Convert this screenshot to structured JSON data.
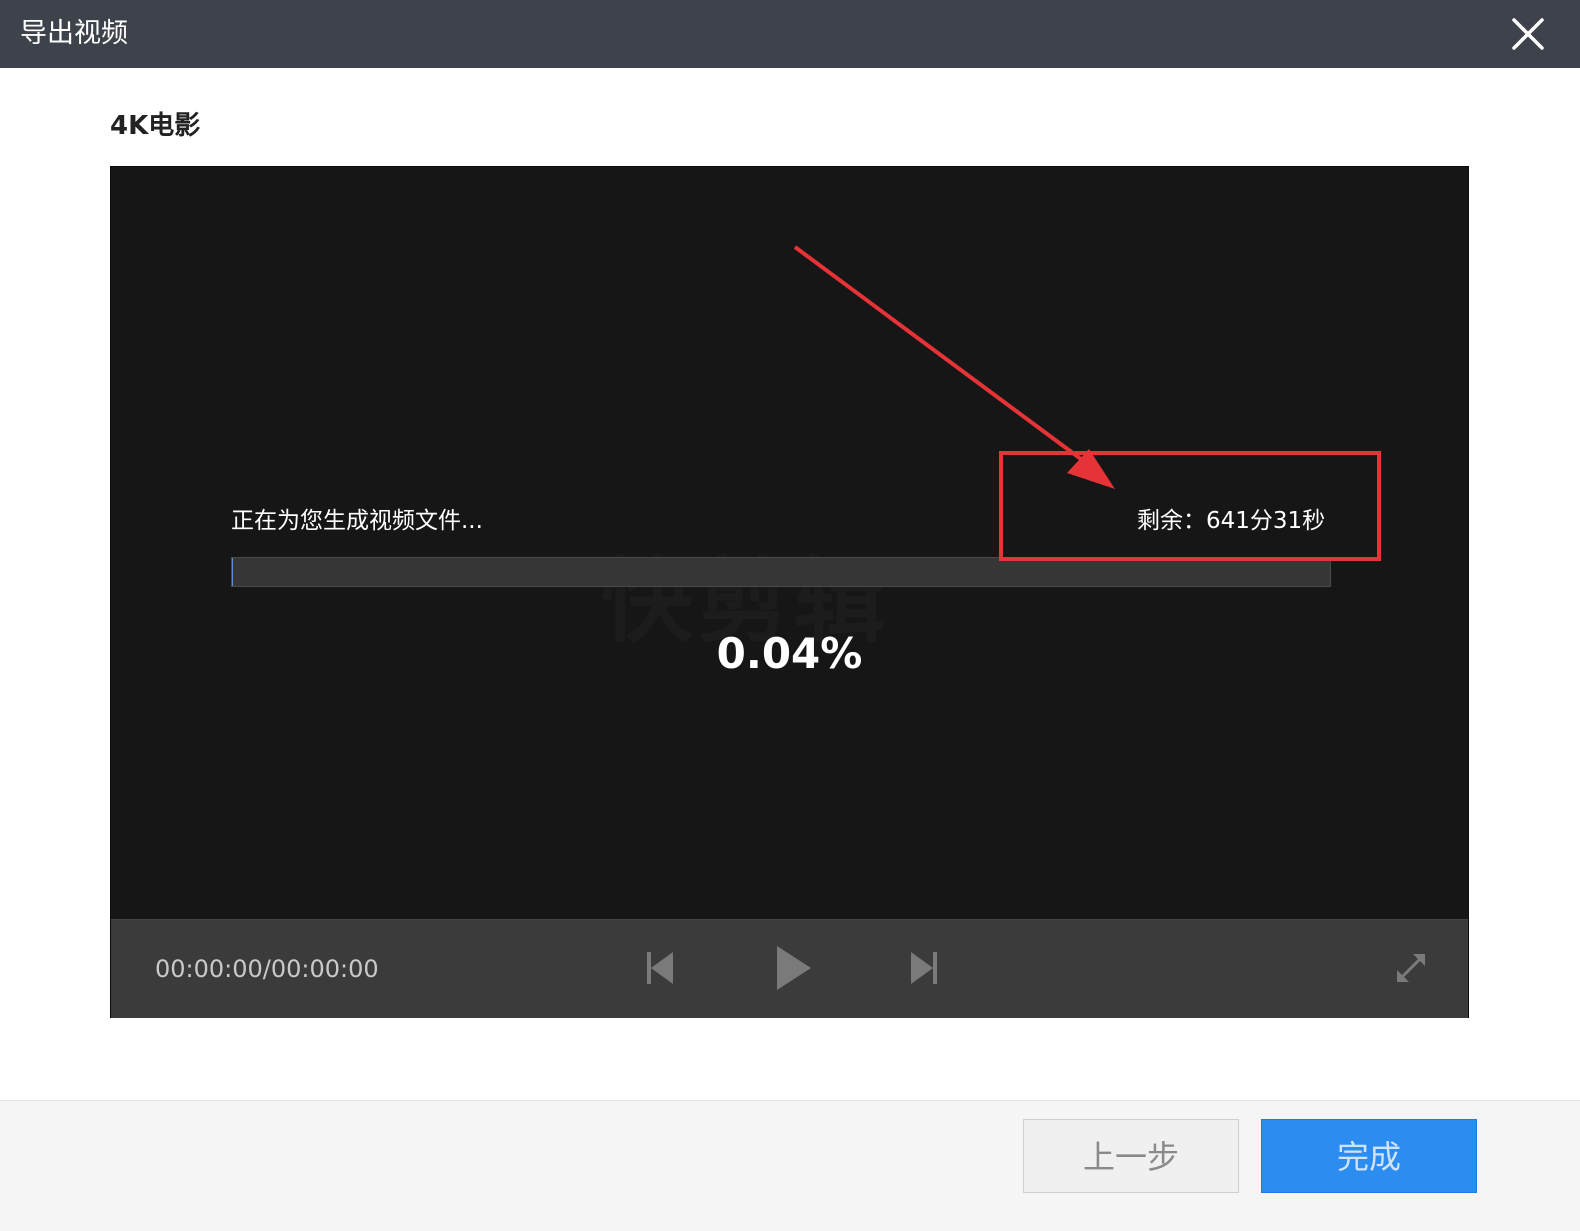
{
  "window": {
    "title": "导出视频",
    "close_icon": "close-icon"
  },
  "content": {
    "title": "4K电影"
  },
  "player": {
    "watermark": "快剪辑",
    "status_text": "正在为您生成视频文件...",
    "remaining_text": "剩余：641分31秒",
    "progress_percent_text": "0.04%",
    "progress_fraction": 0.0004,
    "timecode": "00:00:00/00:00:00",
    "icons": {
      "prev": "skip-previous-icon",
      "play": "play-icon",
      "next": "skip-next-icon",
      "fullscreen": "fullscreen-icon"
    },
    "annotation_color": "#e63337"
  },
  "footer": {
    "prev_label": "上一步",
    "done_label": "完成",
    "done_color": "#2d8cf0"
  }
}
